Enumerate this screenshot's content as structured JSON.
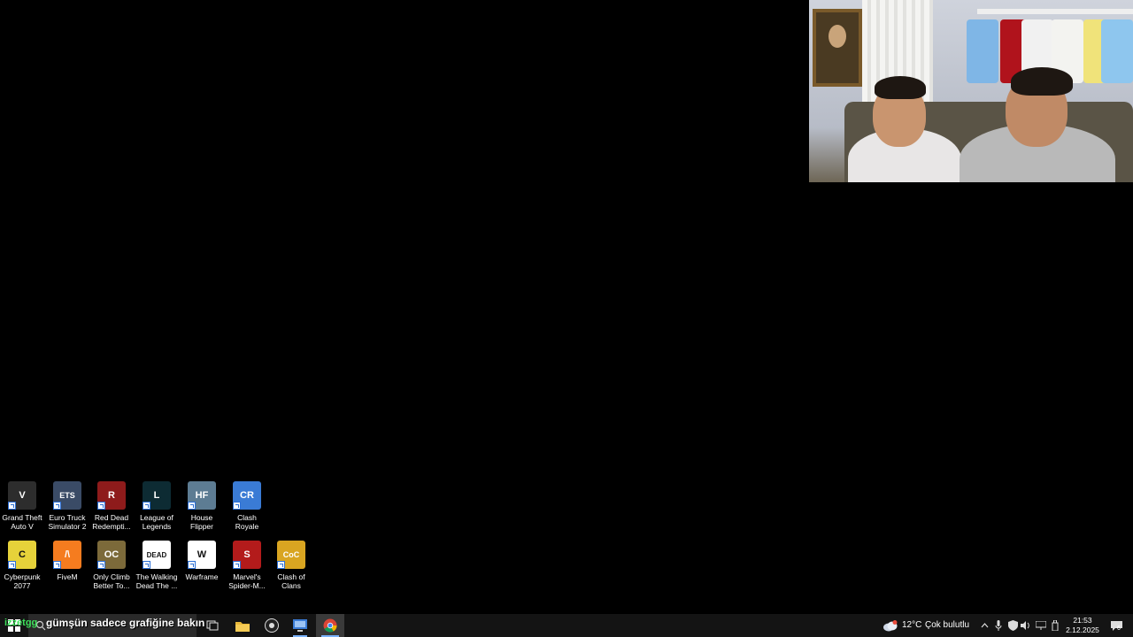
{
  "desktop_icons": [
    {
      "label": "Grand Theft\nAuto V",
      "icon": "gta-v-icon",
      "color": "#2d2d2d",
      "glyph": "V"
    },
    {
      "label": "Euro Truck\nSimulator 2",
      "icon": "euro-truck-icon",
      "color": "#3a4b66",
      "glyph": "ETS"
    },
    {
      "label": "Red Dead\nRedempti...",
      "icon": "red-dead-icon",
      "color": "#8e1b1b",
      "glyph": "R"
    },
    {
      "label": "League of\nLegends",
      "icon": "league-of-legends-icon",
      "color": "#0d2b33",
      "glyph": "L"
    },
    {
      "label": "House\nFlipper",
      "icon": "house-flipper-icon",
      "color": "#5d7c93",
      "glyph": "HF"
    },
    {
      "label": "Clash Royale",
      "icon": "clash-royale-icon",
      "color": "#3a7bd5",
      "glyph": "CR"
    },
    {
      "label": "Cyberpunk\n2077",
      "icon": "cyberpunk-icon",
      "color": "#e6d23a",
      "glyph": "C"
    },
    {
      "label": "FiveM",
      "icon": "fivem-icon",
      "color": "#f57c1f",
      "glyph": "/\\"
    },
    {
      "label": "Only Climb\nBetter To...",
      "icon": "only-climb-icon",
      "color": "#7c6a3a",
      "glyph": "OC"
    },
    {
      "label": "The Walking\nDead The ...",
      "icon": "walking-dead-icon",
      "color": "#ffffff",
      "glyph": "DEAD"
    },
    {
      "label": "Warframe",
      "icon": "warframe-icon",
      "color": "#ffffff",
      "glyph": "W"
    },
    {
      "label": "Marvel's\nSpider-M...",
      "icon": "spiderman-icon",
      "color": "#b31b1b",
      "glyph": "S"
    },
    {
      "label": "Clash of\nClans",
      "icon": "clash-of-clans-icon",
      "color": "#d9a521",
      "glyph": "CoC"
    }
  ],
  "chat_overlay": {
    "username": "izzetgg",
    "message": "gümşün sadece grafiğine bakın"
  },
  "taskbar": {
    "weather_temp": "12°C",
    "weather_desc": "Çok bulutlu",
    "time": "21:53",
    "date": "2.12.2025",
    "notification_count": "6"
  }
}
